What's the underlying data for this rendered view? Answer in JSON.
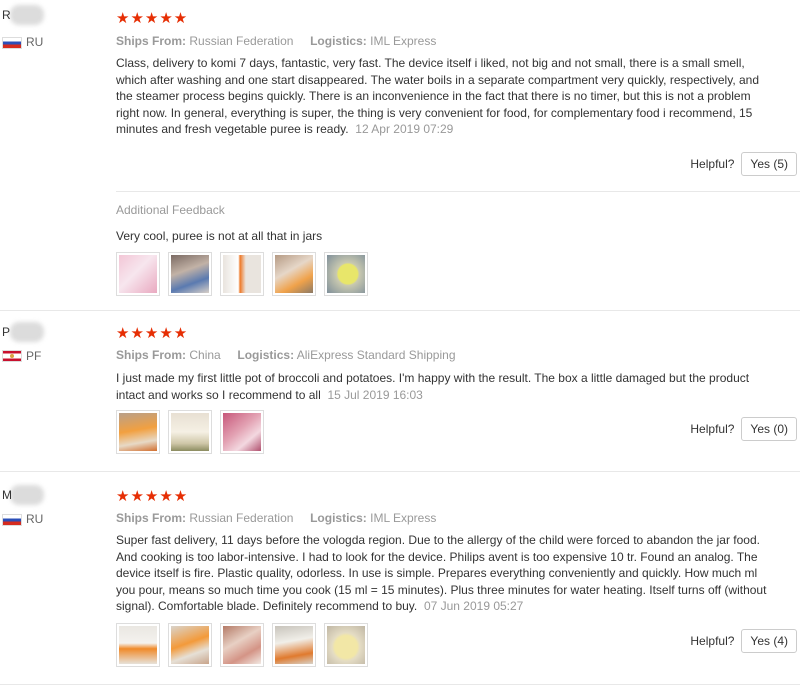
{
  "colors": {
    "star": "#e62e04",
    "muted": "#999999",
    "text": "#333333"
  },
  "reviews": [
    {
      "initial": "R",
      "country": "RU",
      "stars": "★★★★★",
      "ships_from_label": "Ships From:",
      "ships_from": "Russian Federation",
      "logistics_label": "Logistics:",
      "logistics": "IML Express",
      "text": "Class, delivery to komi 7 days, fantastic, very fast. The device itself i liked, not big and not small, there is a small smell, which after washing and one start disappeared. The water boils in a separate compartment very quickly, respectively, and the steamer process begins quickly. There is an inconvenience in the fact that there is no timer, but this is not a problem right now. In general, everything is super, the thing is very convenient for food, for complementary food i recommend, 15 minutes and fresh vegetable puree is ready.",
      "date": "12 Apr 2019 07:29",
      "helpful_label": "Helpful?",
      "yes_label": "Yes (5)",
      "additional_feedback_label": "Additional Feedback",
      "additional_feedback": "Very cool, puree is not at all that in jars"
    },
    {
      "initial": "P",
      "country": "PF",
      "stars": "★★★★★",
      "ships_from_label": "Ships From:",
      "ships_from": "China",
      "logistics_label": "Logistics:",
      "logistics": "AliExpress Standard Shipping",
      "text": "I just made my first little pot of broccoli and potatoes. I'm happy with the result. The box a little damaged but the product intact and works so I recommend to all",
      "date": "15 Jul 2019 16:03",
      "helpful_label": "Helpful?",
      "yes_label": "Yes (0)"
    },
    {
      "initial": "M",
      "country": "RU",
      "stars": "★★★★★",
      "ships_from_label": "Ships From:",
      "ships_from": "Russian Federation",
      "logistics_label": "Logistics:",
      "logistics": "IML Express",
      "text": "Super fast delivery, 11 days before the vologda region. Due to the allergy of the child were forced to abandon the jar food. And cooking is too labor-intensive. I had to look for the device. Philips avent is too expensive 10 tr. Found an analog. The device itself is fire. Plastic quality, odorless. In use is simple. Prepares everything conveniently and quickly. How much ml you pour, means so much time you cook (15 ml = 15 minutes). Plus three minutes for water heating. Itself turns off (without signal). Comfortable blade. Definitely recommend to buy.",
      "date": "07 Jun 2019 05:27",
      "helpful_label": "Helpful?",
      "yes_label": "Yes (4)"
    }
  ]
}
